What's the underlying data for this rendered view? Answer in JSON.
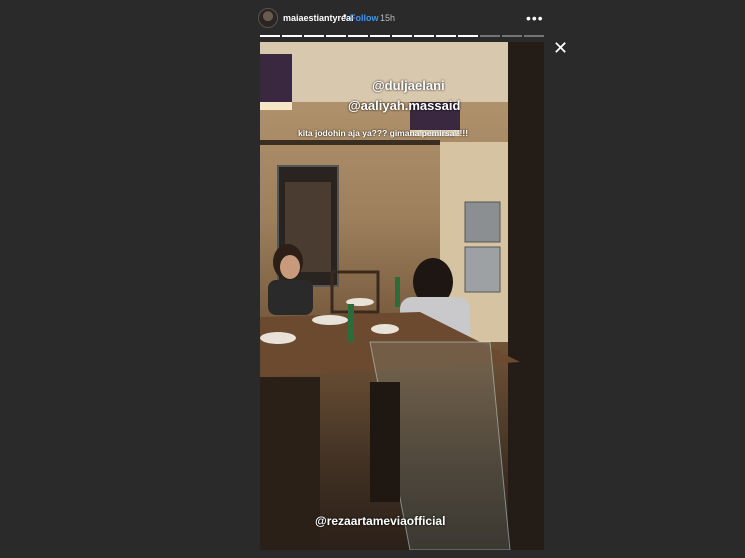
{
  "header": {
    "username": "maiaestiantyreal",
    "separator": "•",
    "follow_label": "Follow",
    "time": "15h",
    "more_label": "•••"
  },
  "progress": {
    "total_segments": 13,
    "completed_segments": 10
  },
  "close_label": "✕",
  "story": {
    "mention_1": "@duljaelani",
    "mention_2": "@aaliyah.massaid",
    "caption": "kita jodohin aja ya??? gimana pemirsa !!!!",
    "mention_3": "@rezaartameviaofficial"
  },
  "colors": {
    "follow": "#3897f0",
    "background": "#2a2a2a"
  }
}
